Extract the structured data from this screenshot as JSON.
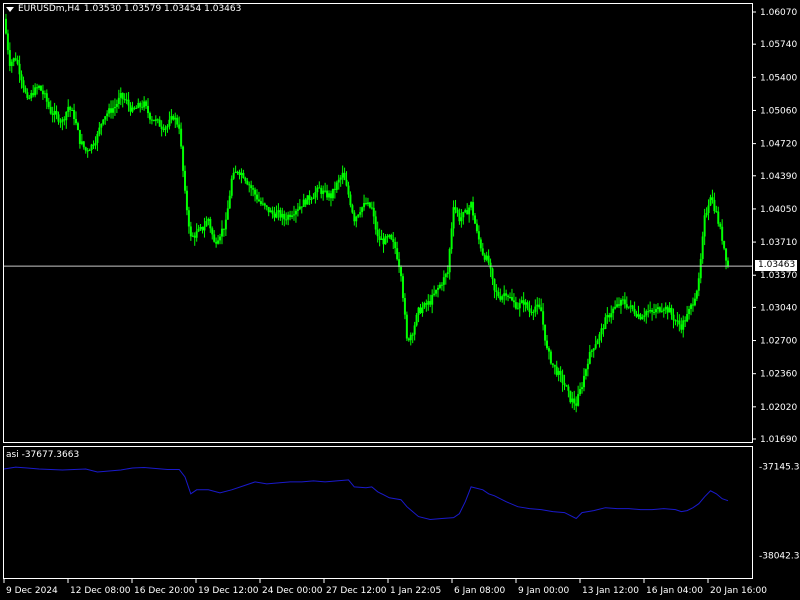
{
  "header": {
    "symbol": "EURUSDm,H4",
    "ohlc": "1.03530 1.03579 1.03454 1.03463"
  },
  "indicator": {
    "label": "asi -37677.3663"
  },
  "current_price": "1.03463",
  "colors": {
    "background": "#000000",
    "candle": "#00ff00",
    "indicator_line": "#1a1acc",
    "grid_line": "#ffffff"
  },
  "chart_data": [
    {
      "type": "candlestick",
      "symbol": "EURUSDm",
      "timeframe": "H4",
      "y_ticks": [
        "1.06070",
        "1.05740",
        "1.05400",
        "1.05060",
        "1.04720",
        "1.04390",
        "1.04050",
        "1.03710",
        "1.03370",
        "1.03040",
        "1.02700",
        "1.02360",
        "1.02020",
        "1.01690"
      ],
      "x_ticks": [
        "9 Dec 2024",
        "12 Dec 08:00",
        "16 Dec 20:00",
        "19 Dec 12:00",
        "24 Dec 00:00",
        "27 Dec 12:00",
        "1 Jan 22:05",
        "6 Jan 08:00",
        "9 Jan 00:00",
        "13 Jan 12:00",
        "16 Jan 04:00",
        "20 Jan 16:00"
      ],
      "ylim": [
        1.0169,
        1.0607
      ],
      "close_path": [
        [
          0,
          1.06
        ],
        [
          1,
          1.0555
        ],
        [
          2,
          1.056
        ],
        [
          3,
          1.054
        ],
        [
          4,
          1.0515
        ],
        [
          5,
          1.0525
        ],
        [
          6,
          1.053
        ],
        [
          7,
          1.052
        ],
        [
          8,
          1.0505
        ],
        [
          9,
          1.05
        ],
        [
          10,
          1.0495
        ],
        [
          11,
          1.051
        ],
        [
          12,
          1.05
        ],
        [
          13,
          1.0475
        ],
        [
          14,
          1.0465
        ],
        [
          15,
          1.047
        ],
        [
          16,
          1.048
        ],
        [
          17,
          1.05
        ],
        [
          18,
          1.0505
        ],
        [
          19,
          1.051
        ],
        [
          20,
          1.052
        ],
        [
          21,
          1.0515
        ],
        [
          22,
          1.0505
        ],
        [
          23,
          1.051
        ],
        [
          24,
          1.0512
        ],
        [
          25,
          1.05
        ],
        [
          26,
          1.0495
        ],
        [
          27,
          1.049
        ],
        [
          28,
          1.049
        ],
        [
          29,
          1.05
        ],
        [
          30,
          1.049
        ],
        [
          31,
          1.042
        ],
        [
          32,
          1.0375
        ],
        [
          33,
          1.038
        ],
        [
          34,
          1.0385
        ],
        [
          35,
          1.0395
        ],
        [
          36,
          1.037
        ],
        [
          37,
          1.038
        ],
        [
          38,
          1.039
        ],
        [
          39,
          1.0435
        ],
        [
          40,
          1.0445
        ],
        [
          41,
          1.044
        ],
        [
          42,
          1.043
        ],
        [
          43,
          1.042
        ],
        [
          44,
          1.041
        ],
        [
          45,
          1.0405
        ],
        [
          46,
          1.04
        ],
        [
          47,
          1.04
        ],
        [
          48,
          1.0395
        ],
        [
          49,
          1.04
        ],
        [
          50,
          1.0405
        ],
        [
          51,
          1.041
        ],
        [
          52,
          1.0415
        ],
        [
          53,
          1.042
        ],
        [
          54,
          1.0425
        ],
        [
          55,
          1.042
        ],
        [
          56,
          1.0418
        ],
        [
          57,
          1.043
        ],
        [
          58,
          1.044
        ],
        [
          59,
          1.042
        ],
        [
          60,
          1.0395
        ],
        [
          61,
          1.0405
        ],
        [
          62,
          1.041
        ],
        [
          63,
          1.0405
        ],
        [
          64,
          1.0375
        ],
        [
          65,
          1.0372
        ],
        [
          66,
          1.0375
        ],
        [
          67,
          1.0365
        ],
        [
          68,
          1.034
        ],
        [
          69,
          1.027
        ],
        [
          70,
          1.028
        ],
        [
          71,
          1.03
        ],
        [
          72,
          1.0305
        ],
        [
          73,
          1.031
        ],
        [
          74,
          1.032
        ],
        [
          75,
          1.033
        ],
        [
          76,
          1.034
        ],
        [
          77,
          1.041
        ],
        [
          78,
          1.0395
        ],
        [
          79,
          1.04
        ],
        [
          80,
          1.041
        ],
        [
          81,
          1.038
        ],
        [
          82,
          1.036
        ],
        [
          83,
          1.035
        ],
        [
          84,
          1.032
        ],
        [
          85,
          1.0315
        ],
        [
          86,
          1.032
        ],
        [
          87,
          1.031
        ],
        [
          88,
          1.0305
        ],
        [
          89,
          1.031
        ],
        [
          90,
          1.03
        ],
        [
          91,
          1.0305
        ],
        [
          92,
          1.03
        ],
        [
          93,
          1.026
        ],
        [
          94,
          1.0245
        ],
        [
          95,
          1.0235
        ],
        [
          96,
          1.0225
        ],
        [
          97,
          1.021
        ],
        [
          98,
          1.0205
        ],
        [
          99,
          1.0225
        ],
        [
          100,
          1.025
        ],
        [
          101,
          1.0265
        ],
        [
          102,
          1.0275
        ],
        [
          103,
          1.029
        ],
        [
          104,
          1.03
        ],
        [
          105,
          1.0305
        ],
        [
          106,
          1.031
        ],
        [
          107,
          1.0305
        ],
        [
          108,
          1.03
        ],
        [
          109,
          1.0295
        ],
        [
          110,
          1.03
        ],
        [
          111,
          1.0298
        ],
        [
          112,
          1.0302
        ],
        [
          113,
          1.0305
        ],
        [
          114,
          1.03
        ],
        [
          115,
          1.029
        ],
        [
          116,
          1.0285
        ],
        [
          117,
          1.0295
        ],
        [
          118,
          1.031
        ],
        [
          119,
          1.033
        ],
        [
          120,
          1.0395
        ],
        [
          121,
          1.042
        ],
        [
          122,
          1.04
        ],
        [
          123,
          1.0375
        ],
        [
          124,
          1.0346
        ]
      ]
    },
    {
      "type": "line",
      "name": "asi",
      "y_ticks": [
        "-37145.30",
        "-38042.36"
      ],
      "ylim": [
        -38230,
        -36998
      ],
      "points": [
        [
          0,
          -37170
        ],
        [
          2,
          -37150
        ],
        [
          4,
          -37160
        ],
        [
          6,
          -37170
        ],
        [
          8,
          -37175
        ],
        [
          10,
          -37180
        ],
        [
          12,
          -37175
        ],
        [
          14,
          -37170
        ],
        [
          16,
          -37200
        ],
        [
          18,
          -37190
        ],
        [
          20,
          -37180
        ],
        [
          22,
          -37160
        ],
        [
          24,
          -37155
        ],
        [
          26,
          -37165
        ],
        [
          28,
          -37175
        ],
        [
          30,
          -37175
        ],
        [
          31,
          -37250
        ],
        [
          32,
          -37420
        ],
        [
          33,
          -37380
        ],
        [
          35,
          -37380
        ],
        [
          37,
          -37410
        ],
        [
          39,
          -37380
        ],
        [
          41,
          -37340
        ],
        [
          43,
          -37300
        ],
        [
          45,
          -37320
        ],
        [
          47,
          -37310
        ],
        [
          49,
          -37300
        ],
        [
          51,
          -37300
        ],
        [
          53,
          -37290
        ],
        [
          55,
          -37300
        ],
        [
          57,
          -37290
        ],
        [
          59,
          -37280
        ],
        [
          60,
          -37350
        ],
        [
          62,
          -37360
        ],
        [
          63,
          -37350
        ],
        [
          64,
          -37400
        ],
        [
          66,
          -37460
        ],
        [
          68,
          -37480
        ],
        [
          69,
          -37550
        ],
        [
          71,
          -37650
        ],
        [
          73,
          -37680
        ],
        [
          75,
          -37670
        ],
        [
          77,
          -37660
        ],
        [
          78,
          -37620
        ],
        [
          79,
          -37500
        ],
        [
          80,
          -37350
        ],
        [
          82,
          -37380
        ],
        [
          83,
          -37420
        ],
        [
          84,
          -37440
        ],
        [
          86,
          -37500
        ],
        [
          88,
          -37550
        ],
        [
          90,
          -37570
        ],
        [
          92,
          -37580
        ],
        [
          94,
          -37600
        ],
        [
          96,
          -37610
        ],
        [
          97,
          -37640
        ],
        [
          98,
          -37670
        ],
        [
          99,
          -37610
        ],
        [
          101,
          -37590
        ],
        [
          103,
          -37560
        ],
        [
          105,
          -37570
        ],
        [
          107,
          -37570
        ],
        [
          109,
          -37580
        ],
        [
          111,
          -37580
        ],
        [
          113,
          -37570
        ],
        [
          115,
          -37580
        ],
        [
          116,
          -37600
        ],
        [
          117,
          -37590
        ],
        [
          118,
          -37560
        ],
        [
          119,
          -37520
        ],
        [
          120,
          -37450
        ],
        [
          121,
          -37390
        ],
        [
          122,
          -37420
        ],
        [
          123,
          -37470
        ],
        [
          124,
          -37490
        ]
      ]
    }
  ]
}
